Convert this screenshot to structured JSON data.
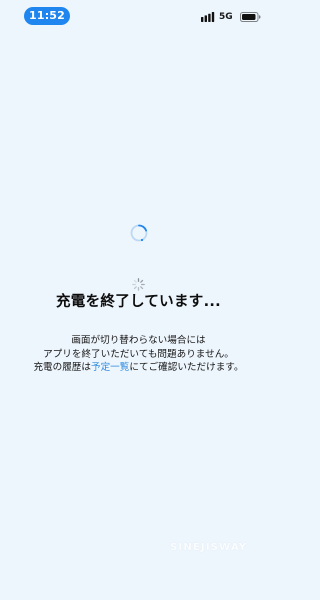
{
  "status_bar": {
    "time": "11:52",
    "network": "5G",
    "signal_icon": "signal-bars-icon",
    "battery_icon": "battery-icon"
  },
  "screen": {
    "title": "充電を終了しています...",
    "message_line1": "画面が切り替わらない場合には",
    "message_line2": "アプリを終了いただいても問題ありません。",
    "message_line3_prefix": "充電の履歴は",
    "message_line3_link": "予定一覧",
    "message_line3_suffix": "にてご確認いただけます。"
  },
  "watermark": "SINEJISWAY",
  "colors": {
    "background": "#eef6fd",
    "time_pill": "#1f86ef",
    "link": "#2f8ae0",
    "spinner": "#1f86ef"
  }
}
